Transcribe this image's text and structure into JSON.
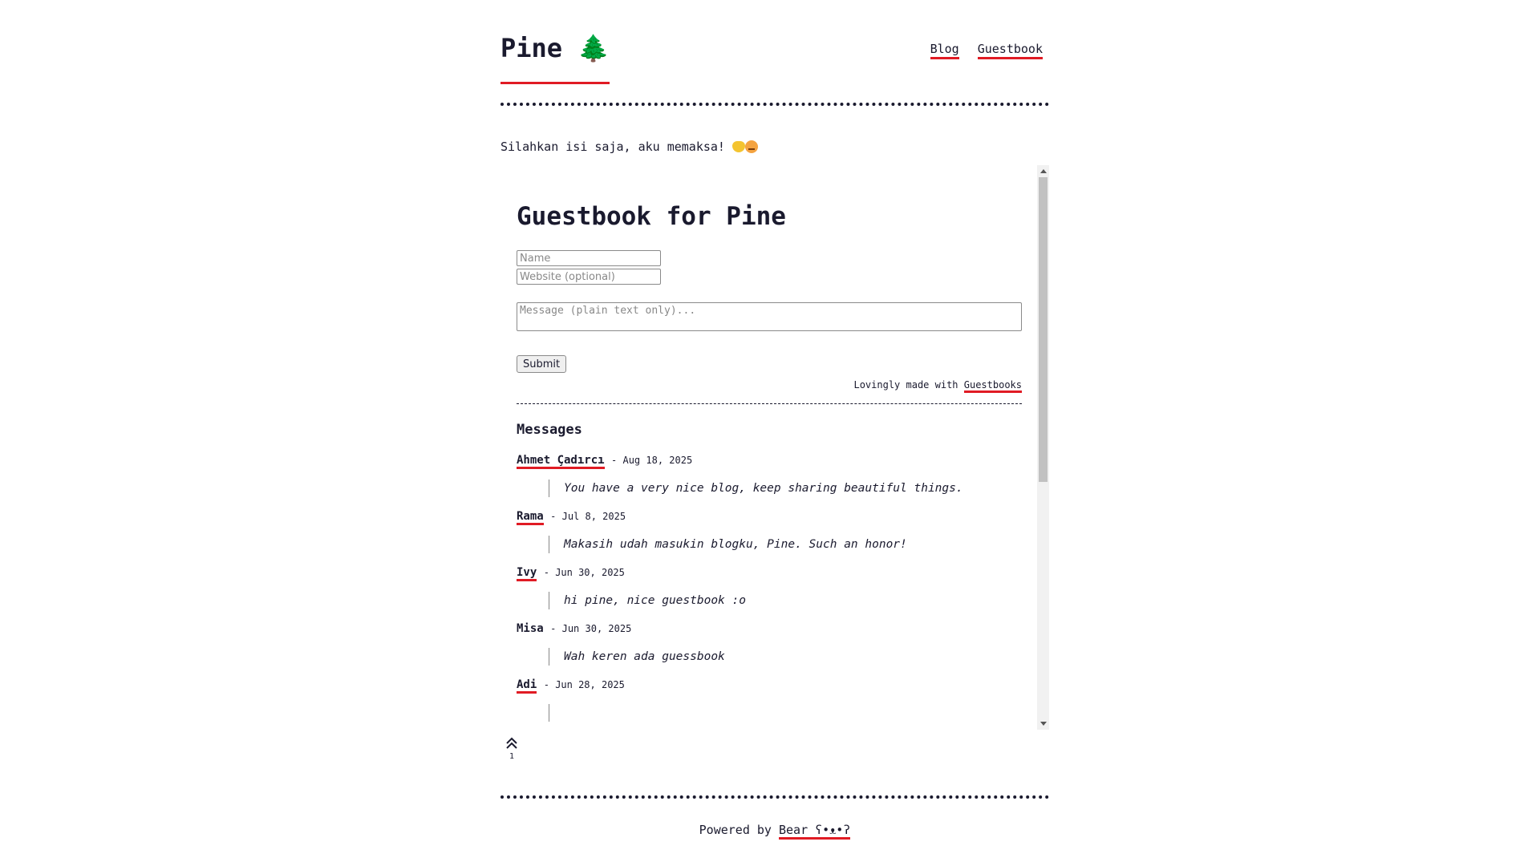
{
  "site": {
    "title": "Pine 🌲"
  },
  "nav": {
    "items": [
      "Blog",
      "Guestbook"
    ]
  },
  "intro": {
    "text": "Silahkan isi saja, aku memaksa! "
  },
  "guestbook": {
    "title": "Guestbook for Pine",
    "name_placeholder": "Name",
    "website_placeholder": "Website (optional)",
    "message_placeholder": "Message (plain text only)...",
    "submit_label": "Submit",
    "made_with_prefix": "Lovingly made with ",
    "made_with_link": "Guestbooks",
    "messages_heading": "Messages",
    "entries": [
      {
        "name": "Ahmet Çadırcı",
        "date": "Aug 18, 2025",
        "message": "You have a very nice blog, keep sharing beautiful things.",
        "linked": true
      },
      {
        "name": "Rama",
        "date": "Jul 8, 2025",
        "message": "Makasih udah masukin blogku, Pine. Such an honor!",
        "linked": true
      },
      {
        "name": "Ivy",
        "date": "Jun 30, 2025",
        "message": "hi pine, nice guestbook :o",
        "linked": true
      },
      {
        "name": "Misa",
        "date": "Jun 30, 2025",
        "message": "Wah keren ada guessbook",
        "linked": false
      },
      {
        "name": "Adi",
        "date": "Jun 28, 2025",
        "message": "",
        "linked": true
      }
    ]
  },
  "upvote": {
    "count": "1"
  },
  "footer": {
    "prefix": "Powered by ",
    "link": "Bear ʕ•ᴥ•ʔ"
  },
  "colors": {
    "accent": "#e01b24",
    "text": "#1a1a2e"
  }
}
